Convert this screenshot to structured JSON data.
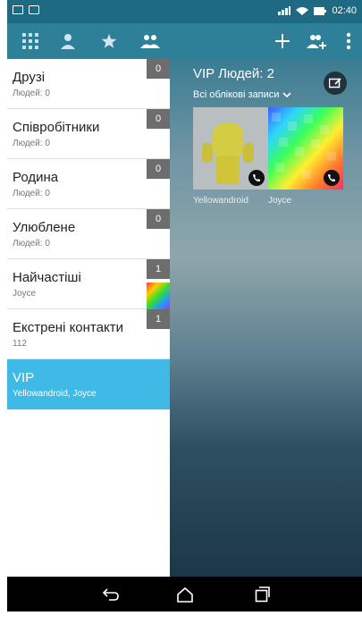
{
  "status_bar": {
    "time": "02:40"
  },
  "toolbar": {
    "icons": [
      "apps-grid-icon",
      "person-icon",
      "star-icon",
      "groups-icon",
      "add-icon",
      "add-group-icon",
      "more-vert-icon"
    ]
  },
  "groups": [
    {
      "name": "Друзі",
      "sub": "Людей: 0",
      "count": "0"
    },
    {
      "name": "Співробітники",
      "sub": "Людей: 0",
      "count": "0"
    },
    {
      "name": "Родина",
      "sub": "Людей: 0",
      "count": "0"
    },
    {
      "name": "Улюблене",
      "sub": "Людей: 0",
      "count": "0"
    },
    {
      "name": "Найчастіші",
      "sub": "Joyce",
      "count": "1"
    },
    {
      "name": "Екстрені контакти",
      "sub": "112",
      "count": "1"
    },
    {
      "name": "VIP",
      "sub": "Yellowandroid, Joyce",
      "count": "",
      "selected": true
    }
  ],
  "vip": {
    "title": "VIP Людей: 2",
    "accounts_label": "Всі облікові записи",
    "contacts": [
      {
        "name": "Yellowandroid"
      },
      {
        "name": "Joyce"
      }
    ]
  },
  "colors": {
    "accent": "#3fb9e6",
    "toolbar": "#2e7f98",
    "statusbar": "#1e6a82"
  }
}
